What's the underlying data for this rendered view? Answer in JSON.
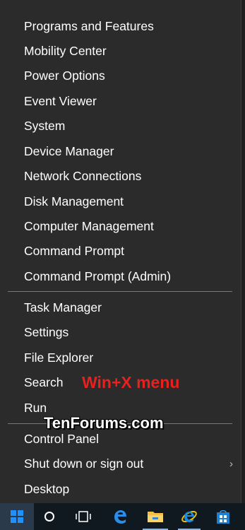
{
  "menu": {
    "group1": [
      {
        "label": "Programs and Features"
      },
      {
        "label": "Mobility Center"
      },
      {
        "label": "Power Options"
      },
      {
        "label": "Event Viewer"
      },
      {
        "label": "System"
      },
      {
        "label": "Device Manager"
      },
      {
        "label": "Network Connections"
      },
      {
        "label": "Disk Management"
      },
      {
        "label": "Computer Management"
      },
      {
        "label": "Command Prompt"
      },
      {
        "label": "Command Prompt (Admin)"
      }
    ],
    "group2": [
      {
        "label": "Task Manager"
      },
      {
        "label": "Settings"
      },
      {
        "label": "File Explorer"
      },
      {
        "label": "Search"
      },
      {
        "label": "Run"
      }
    ],
    "group3": [
      {
        "label": "Control Panel"
      },
      {
        "label": "Shut down or sign out"
      },
      {
        "label": "Desktop"
      }
    ],
    "submenu_arrow": "›"
  },
  "overlay": {
    "caption": "Win+X menu",
    "watermark": "TenForums.com"
  },
  "taskbar": {
    "icons": [
      "windows-logo-icon",
      "search-circle-icon",
      "task-view-icon",
      "edge-icon",
      "file-explorer-icon",
      "internet-explorer-icon",
      "store-icon"
    ]
  },
  "colors": {
    "menu_bg": "#2b2b2b",
    "menu_text": "#ffffff",
    "separator": "#777777",
    "caption_red": "#e8201e",
    "taskbar_bg": "#101820",
    "accent_blue": "#1e90ff"
  }
}
